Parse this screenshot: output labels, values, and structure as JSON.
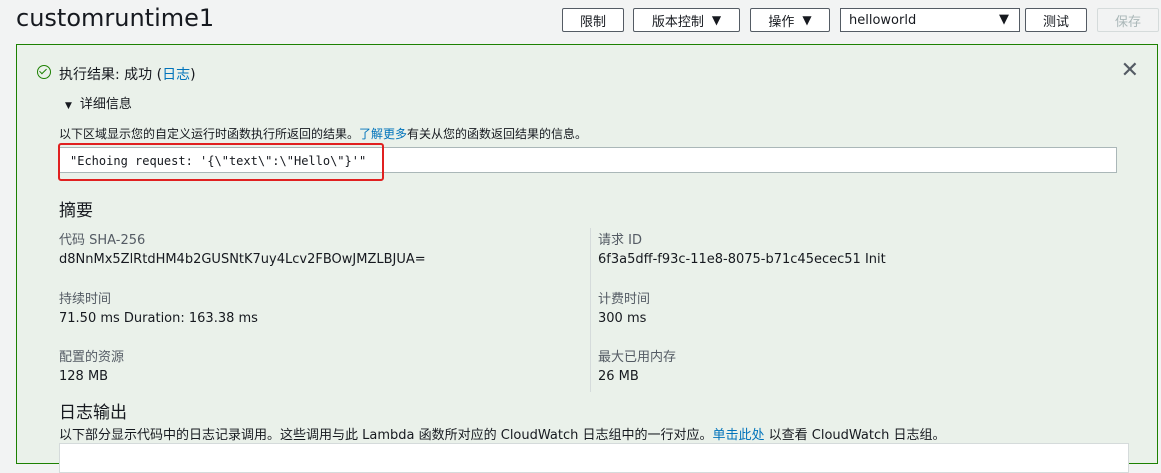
{
  "header": {
    "title": "customruntime1",
    "throttle_label": "限制",
    "version_label": "版本控制",
    "actions_label": "操作",
    "test_event_value": "helloworld",
    "test_label": "测试",
    "save_label": "保存"
  },
  "result": {
    "status_text": "执行结果: 成功 (",
    "log_link": "日志",
    "status_close": ")",
    "details_label": "详细信息",
    "description": "以下区域显示您的自定义运行时函数执行所返回的结果。",
    "learn_more": "了解更多",
    "description_suffix": "有关从您的函数返回结果的信息。",
    "output": "\"Echoing request: '{\\\"text\\\":\\\"Hello\\\"}'\""
  },
  "summary": {
    "heading": "摘要",
    "code_sha_label": "代码 SHA-256",
    "code_sha_value": "d8NnMx5ZlRtdHM4b2GUSNtK7uy4Lcv2FBOwJMZLBJUA=",
    "request_id_label": "请求 ID",
    "request_id_value": "6f3a5dff-f93c-11e8-8075-b71c45ecec51 Init",
    "duration_label": "持续时间",
    "duration_value": "71.50 ms Duration: 163.38 ms",
    "billed_label": "计费时间",
    "billed_value": "300 ms",
    "configured_label": "配置的资源",
    "configured_value": "128 MB",
    "max_memory_label": "最大已用内存",
    "max_memory_value": "26 MB"
  },
  "log": {
    "heading": "日志输出",
    "description": "以下部分显示代码中的日志记录调用。这些调用与此 Lambda 函数所对应的 CloudWatch 日志组中的一行对应。",
    "click_here": "单击此处",
    "description_suffix": " 以查看 CloudWatch 日志组。"
  },
  "colors": {
    "success_green": "#1d8102",
    "panel_background": "#eaf1ea",
    "link_blue": "#0073bb",
    "highlight_red": "#e02020"
  }
}
